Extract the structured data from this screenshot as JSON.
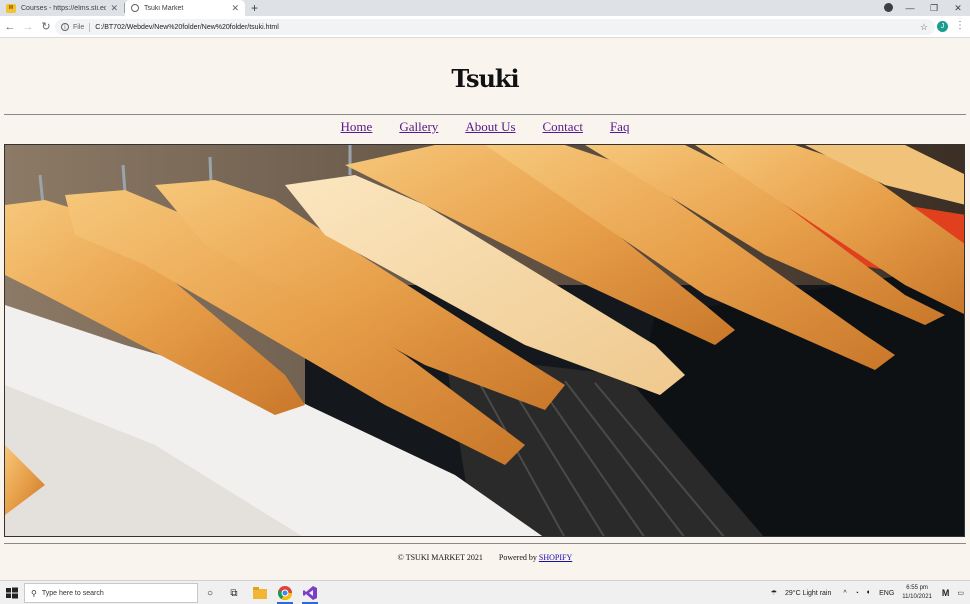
{
  "browser": {
    "tabs": [
      {
        "title": "Courses - https://elms.sti.edu/st...",
        "favicon": "moodle-icon",
        "active": false
      },
      {
        "title": "Tsuki Market",
        "favicon": "globe-icon",
        "active": true
      }
    ],
    "address": {
      "scheme": "File",
      "url": "C:/BT702/Webdev/New%20folder/New%20folder/tsuki.html"
    },
    "account_initial": "J"
  },
  "site": {
    "logo": "Tsuki",
    "nav": [
      "Home",
      "Gallery",
      "About Us",
      "Contact",
      "Faq"
    ],
    "hero_image": "clothes-on-wooden-hangers",
    "footer": {
      "copyright": "© TSUKI MARKET 2021",
      "powered_prefix": "Powered by",
      "powered_link": "SHOPIFY"
    }
  },
  "taskbar": {
    "search_placeholder": "Type here to search",
    "weather": "29°C  Light rain",
    "language": "ENG",
    "time": "6:55 pm",
    "date": "11/10/2021"
  },
  "colors": {
    "page_bg": "#f9f4ee",
    "link": "#551a8b",
    "footer_link": "#1a0dab",
    "accent": "#2b6cd4"
  }
}
